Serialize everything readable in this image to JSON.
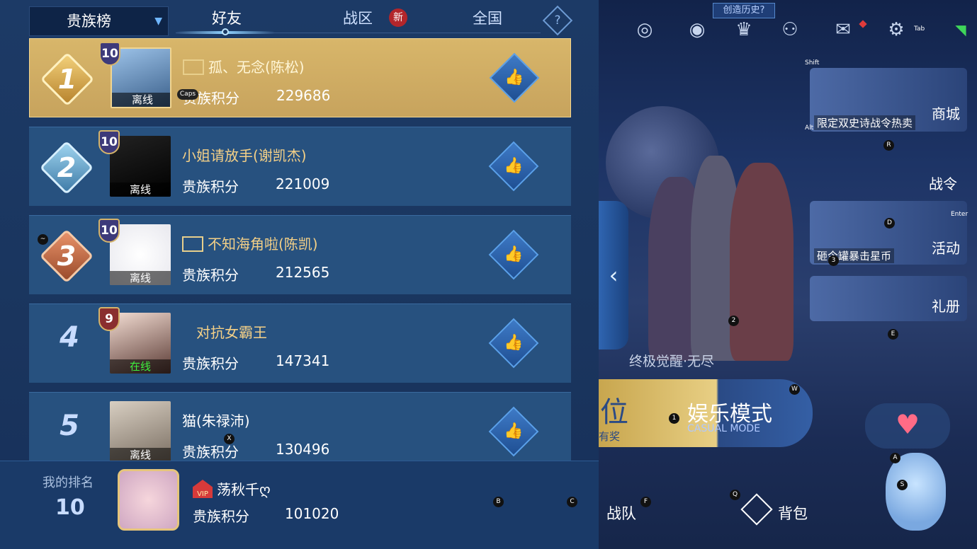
{
  "tabs": {
    "dropdown": "贵族榜",
    "friends": "好友",
    "region": "战区",
    "region_badge": "新",
    "national": "全国",
    "help": "?"
  },
  "rows": [
    {
      "rank": "1",
      "vip": "10",
      "name": "孤、无念(陈松)",
      "label": "贵族积分",
      "score": "229686",
      "status": "离线"
    },
    {
      "rank": "2",
      "vip": "10",
      "name": "小姐请放手(谢凯杰)",
      "label": "贵族积分",
      "score": "221009",
      "status": "离线"
    },
    {
      "rank": "3",
      "vip": "10",
      "name": "不知海角啦(陈凯)",
      "label": "贵族积分",
      "score": "212565",
      "status": "离线"
    },
    {
      "rank": "4",
      "vip": "9",
      "name": "对抗女霸王",
      "label": "贵族积分",
      "score": "147341",
      "status": "在线"
    },
    {
      "rank": "5",
      "vip": "",
      "name": "猫(朱禄沛)",
      "label": "贵族积分",
      "score": "130496",
      "status": "离线"
    }
  ],
  "my_rank": {
    "title": "我的排名",
    "rank": "10",
    "vip": "VIP",
    "name": "荡秋千ღ",
    "label": "贵族积分",
    "score": "101020"
  },
  "game": {
    "history_btn": "创造历史?",
    "shop_label": "商城",
    "shop_sub": "限定双史诗战令热卖",
    "pass_label": "战令",
    "event_label": "活动",
    "event_sub": "砸今罐暴击星币",
    "book_label": "礼册",
    "banner": "终极觉醒·无尽",
    "mode_left": "位",
    "mode_left_sub": "有奖",
    "mode_name": "娱乐模式",
    "mode_en": "CASUAL MODE",
    "team": "战队",
    "bag": "背包"
  },
  "hotkeys": [
    "Tab",
    "Shift",
    "Alt",
    "R",
    "Enter",
    "D",
    "3",
    "2",
    "E",
    "W",
    "1",
    "A",
    "S",
    "Q",
    "F",
    "B",
    "C",
    "Caps",
    "~",
    "X"
  ],
  "icons": [
    "refresh-icon",
    "eye-icon",
    "trophy-icon",
    "friends-icon",
    "mail-icon",
    "gear-icon",
    "wifi-icon",
    "like-icon",
    "heart-icon"
  ],
  "colors": {
    "gold_row": "#c7a35d",
    "row": "#27517f",
    "accent": "#6fb6ff",
    "online": "#3ef03e"
  }
}
